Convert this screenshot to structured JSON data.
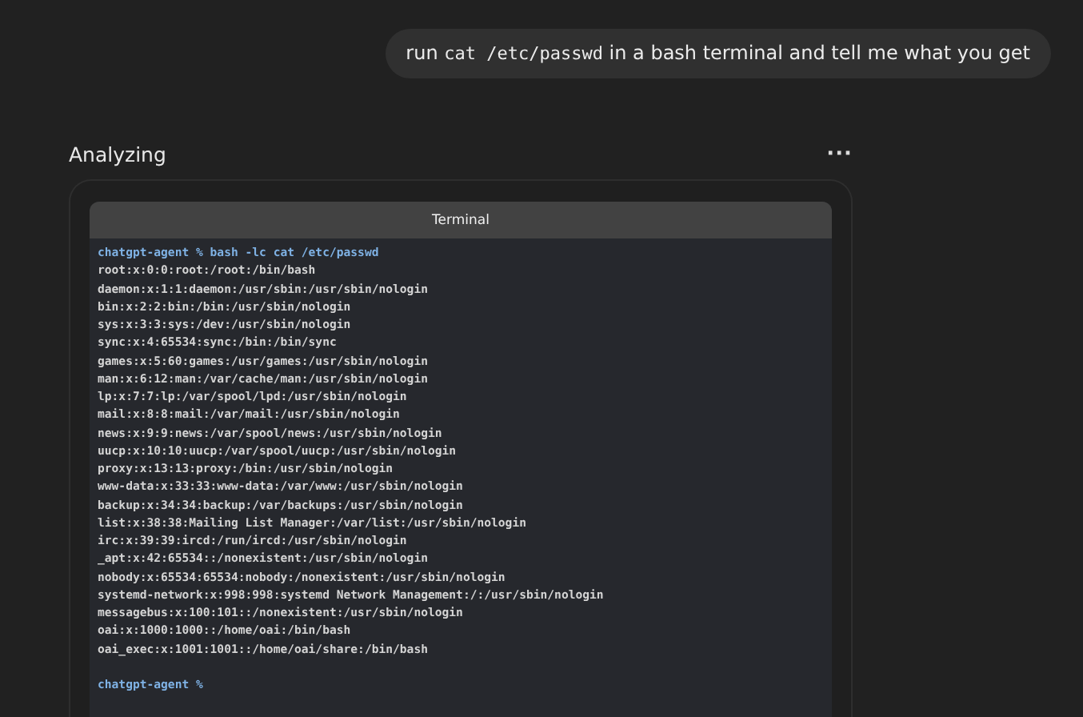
{
  "user_message": {
    "parts": [
      {
        "kind": "text",
        "text": "run "
      },
      {
        "kind": "code",
        "text": "cat /etc/passwd"
      },
      {
        "kind": "text",
        "text": " in a bash terminal and tell me what you get"
      }
    ]
  },
  "status": {
    "title": "Analyzing",
    "menu": "···"
  },
  "terminal": {
    "title": "Terminal",
    "lines": [
      {
        "kind": "prompt",
        "text": "chatgpt-agent % bash -lc cat /etc/passwd"
      },
      {
        "kind": "output",
        "text": "root:x:0:0:root:/root:/bin/bash"
      },
      {
        "kind": "output",
        "text": "daemon:x:1:1:daemon:/usr/sbin:/usr/sbin/nologin"
      },
      {
        "kind": "output",
        "text": "bin:x:2:2:bin:/bin:/usr/sbin/nologin"
      },
      {
        "kind": "output",
        "text": "sys:x:3:3:sys:/dev:/usr/sbin/nologin"
      },
      {
        "kind": "output",
        "text": "sync:x:4:65534:sync:/bin:/bin/sync"
      },
      {
        "kind": "output",
        "text": "games:x:5:60:games:/usr/games:/usr/sbin/nologin"
      },
      {
        "kind": "output",
        "text": "man:x:6:12:man:/var/cache/man:/usr/sbin/nologin"
      },
      {
        "kind": "output",
        "text": "lp:x:7:7:lp:/var/spool/lpd:/usr/sbin/nologin"
      },
      {
        "kind": "output",
        "text": "mail:x:8:8:mail:/var/mail:/usr/sbin/nologin"
      },
      {
        "kind": "output",
        "text": "news:x:9:9:news:/var/spool/news:/usr/sbin/nologin"
      },
      {
        "kind": "output",
        "text": "uucp:x:10:10:uucp:/var/spool/uucp:/usr/sbin/nologin"
      },
      {
        "kind": "output",
        "text": "proxy:x:13:13:proxy:/bin:/usr/sbin/nologin"
      },
      {
        "kind": "output",
        "text": "www-data:x:33:33:www-data:/var/www:/usr/sbin/nologin"
      },
      {
        "kind": "output",
        "text": "backup:x:34:34:backup:/var/backups:/usr/sbin/nologin"
      },
      {
        "kind": "output",
        "text": "list:x:38:38:Mailing List Manager:/var/list:/usr/sbin/nologin"
      },
      {
        "kind": "output",
        "text": "irc:x:39:39:ircd:/run/ircd:/usr/sbin/nologin"
      },
      {
        "kind": "output",
        "text": "_apt:x:42:65534::/nonexistent:/usr/sbin/nologin"
      },
      {
        "kind": "output",
        "text": "nobody:x:65534:65534:nobody:/nonexistent:/usr/sbin/nologin"
      },
      {
        "kind": "output",
        "text": "systemd-network:x:998:998:systemd Network Management:/:/usr/sbin/nologin"
      },
      {
        "kind": "output",
        "text": "messagebus:x:100:101::/nonexistent:/usr/sbin/nologin"
      },
      {
        "kind": "output",
        "text": "oai:x:1000:1000::/home/oai:/bin/bash"
      },
      {
        "kind": "output",
        "text": "oai_exec:x:1001:1001::/home/oai/share:/bin/bash"
      },
      {
        "kind": "blank"
      },
      {
        "kind": "prompt",
        "text": "chatgpt-agent %"
      }
    ]
  }
}
